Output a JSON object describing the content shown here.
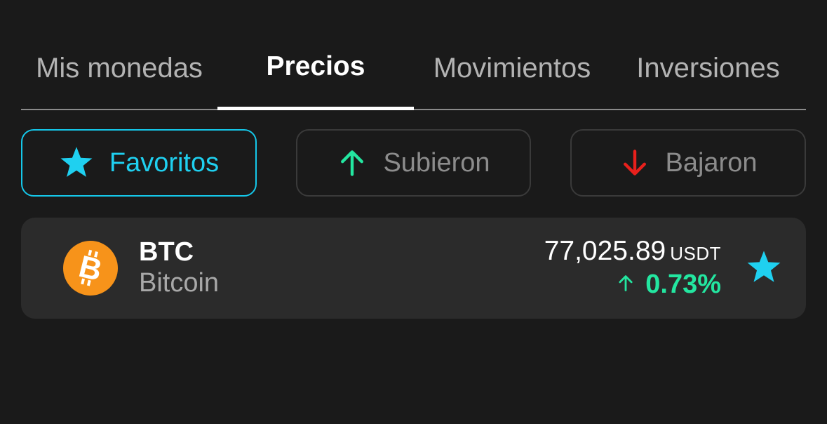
{
  "tabs": [
    {
      "label": "Mis monedas",
      "active": false
    },
    {
      "label": "Precios",
      "active": true
    },
    {
      "label": "Movimientos",
      "active": false
    },
    {
      "label": "Inversiones",
      "active": false
    }
  ],
  "filters": {
    "favorites": {
      "label": "Favoritos",
      "icon": "star-icon",
      "selected": true
    },
    "up": {
      "label": "Subieron",
      "icon": "arrow-up-icon",
      "selected": false
    },
    "down": {
      "label": "Bajaron",
      "icon": "arrow-down-icon",
      "selected": false
    }
  },
  "coins": [
    {
      "symbol": "BTC",
      "name": "Bitcoin",
      "icon": "bitcoin-icon",
      "price": "77,025.89",
      "unit": "USDT",
      "change": "0.73%",
      "change_direction": "up",
      "favorite": true
    }
  ],
  "colors": {
    "background": "#1a1a1a",
    "accent": "#1fd0f0",
    "positive": "#23e6a0",
    "negative": "#e8201c",
    "bitcoin": "#f7931a",
    "card": "#2b2b2b"
  }
}
